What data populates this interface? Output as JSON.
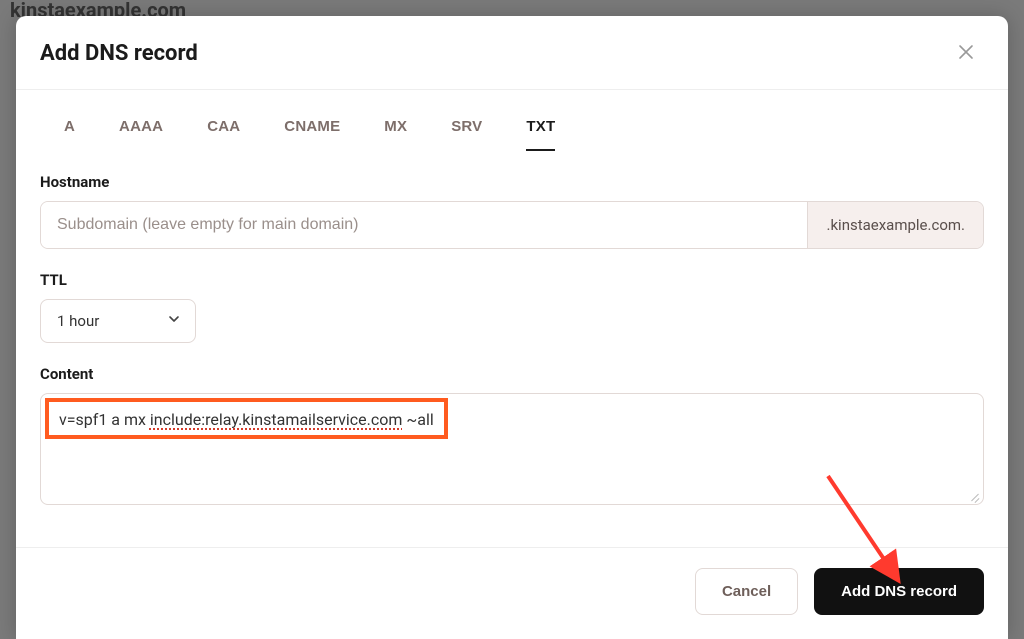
{
  "background": {
    "domain_heading": "kinstaexample.com"
  },
  "modal": {
    "title": "Add DNS record",
    "tabs": [
      "A",
      "AAAA",
      "CAA",
      "CNAME",
      "MX",
      "SRV",
      "TXT"
    ],
    "active_tab": "TXT",
    "hostname": {
      "label": "Hostname",
      "placeholder": "Subdomain (leave empty for main domain)",
      "value": "",
      "suffix": ".kinstaexample.com."
    },
    "ttl": {
      "label": "TTL",
      "selected": "1 hour"
    },
    "content": {
      "label": "Content",
      "value_plain_prefix": "v=spf1 a mx ",
      "value_spellchecked": "include:relay.kinstamailservice.com",
      "value_plain_suffix": " ~all",
      "full_value": "v=spf1 a mx include:relay.kinstamailservice.com ~all"
    },
    "footer": {
      "cancel": "Cancel",
      "submit": "Add DNS record"
    }
  },
  "annotation": {
    "highlight_color": "#ff5b1f",
    "arrow_color": "#ff3a2e"
  }
}
